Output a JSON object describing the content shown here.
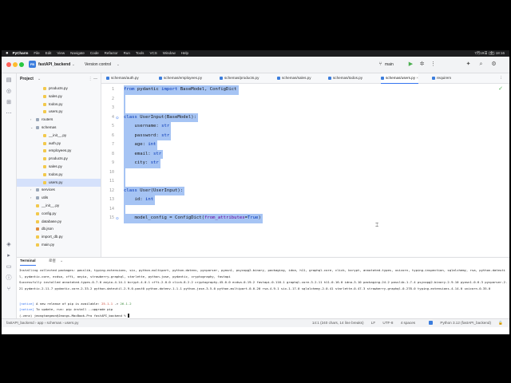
{
  "menubar": {
    "app_name": "PyCharm",
    "items": [
      "File",
      "Edit",
      "View",
      "Navigate",
      "Code",
      "Refactor",
      "Run",
      "Tools",
      "VCS",
      "Window",
      "Help"
    ],
    "status": "7月19日 (金) 18:16"
  },
  "titlebar": {
    "project_badge": "FB",
    "project_name": "fastAPI_backend",
    "vcs_label": "Version control",
    "branch": "main"
  },
  "project_panel": {
    "title": "Project",
    "rows": [
      {
        "label": "products.py",
        "depth": 3,
        "kind": "py",
        "selected": false,
        "arrow": ""
      },
      {
        "label": "sales.py",
        "depth": 3,
        "kind": "py",
        "selected": false,
        "arrow": ""
      },
      {
        "label": "todos.py",
        "depth": 3,
        "kind": "py",
        "selected": false,
        "arrow": ""
      },
      {
        "label": "users.py",
        "depth": 3,
        "kind": "py",
        "selected": false,
        "arrow": ""
      },
      {
        "label": "routers",
        "depth": 2,
        "kind": "folder",
        "selected": false,
        "arrow": "›"
      },
      {
        "label": "schemas",
        "depth": 2,
        "kind": "folder",
        "selected": false,
        "arrow": "⌄"
      },
      {
        "label": "__init__.py",
        "depth": 3,
        "kind": "py",
        "selected": false,
        "arrow": ""
      },
      {
        "label": "auth.py",
        "depth": 3,
        "kind": "py",
        "selected": false,
        "arrow": ""
      },
      {
        "label": "employees.py",
        "depth": 3,
        "kind": "py",
        "selected": false,
        "arrow": ""
      },
      {
        "label": "products.py",
        "depth": 3,
        "kind": "py",
        "selected": false,
        "arrow": ""
      },
      {
        "label": "sales.py",
        "depth": 3,
        "kind": "py",
        "selected": false,
        "arrow": ""
      },
      {
        "label": "todos.py",
        "depth": 3,
        "kind": "py",
        "selected": false,
        "arrow": ""
      },
      {
        "label": "users.py",
        "depth": 3,
        "kind": "py",
        "selected": true,
        "arrow": ""
      },
      {
        "label": "services",
        "depth": 2,
        "kind": "folder",
        "selected": false,
        "arrow": "›"
      },
      {
        "label": "utils",
        "depth": 2,
        "kind": "folder",
        "selected": false,
        "arrow": "›"
      },
      {
        "label": "__init__.py",
        "depth": 2,
        "kind": "py",
        "selected": false,
        "arrow": ""
      },
      {
        "label": "config.py",
        "depth": 2,
        "kind": "py",
        "selected": false,
        "arrow": ""
      },
      {
        "label": "database.py",
        "depth": 2,
        "kind": "py",
        "selected": false,
        "arrow": ""
      },
      {
        "label": "db.json",
        "depth": 2,
        "kind": "json",
        "selected": false,
        "arrow": ""
      },
      {
        "label": "import_db.py",
        "depth": 2,
        "kind": "py",
        "selected": false,
        "arrow": ""
      },
      {
        "label": "main.py",
        "depth": 2,
        "kind": "py",
        "selected": false,
        "arrow": ""
      }
    ]
  },
  "tabs": [
    {
      "label": "schemas/auth.py",
      "active": false
    },
    {
      "label": "schemas/employees.py",
      "active": false
    },
    {
      "label": "schemas/products.py",
      "active": false
    },
    {
      "label": "schemas/sales.py",
      "active": false
    },
    {
      "label": "schemas/todos.py",
      "active": false
    },
    {
      "label": "schemas/users.py",
      "active": true
    },
    {
      "label": "requirem",
      "active": false
    }
  ],
  "editor": {
    "lines": [
      {
        "n": "1",
        "text": "from pydantic import BaseModel, ConfigDict",
        "sel": true
      },
      {
        "n": "2",
        "text": "",
        "sel": true
      },
      {
        "n": "3",
        "text": "",
        "sel": true
      },
      {
        "n": "4",
        "text": "class UserInput(BaseModel):",
        "sel": true,
        "mark": "⊙"
      },
      {
        "n": "5",
        "text": "    username: str",
        "sel": true
      },
      {
        "n": "6",
        "text": "    password: str",
        "sel": true
      },
      {
        "n": "7",
        "text": "    age: int",
        "sel": true
      },
      {
        "n": "8",
        "text": "    email: str",
        "sel": true
      },
      {
        "n": "9",
        "text": "    city: str",
        "sel": true
      },
      {
        "n": "10",
        "text": "",
        "sel": true
      },
      {
        "n": "11",
        "text": "",
        "sel": true
      },
      {
        "n": "12",
        "text": "class User(UserInput):",
        "sel": true
      },
      {
        "n": "13",
        "text": "    id: int",
        "sel": true
      },
      {
        "n": "14",
        "text": "",
        "sel": true
      },
      {
        "n": "15",
        "text": "    model_config = ConfigDict(from_attributes=True)",
        "sel": true,
        "mark": "⊙"
      }
    ]
  },
  "terminal": {
    "tab_active": "Terminal",
    "tab_local": "로컬",
    "lines": [
      "Installing collected packages: passlib, typing-extensions, six, python-multipart, python-dotenv, pycparser, pyasn1, psycopg2-binary, packaging, idna, h11, graphql-core, click, bcrypt, annotated-types, uvicorn, typing-inspection, sqlalchemy, rsa, python-dateutil, pydantic-core, ecdsa, cffi, anyio, strawberry-graphql, starlette, python-jose, pydantic, cryptography, fastapi",
      "Successfully installed annotated-types-0.7.0 anyio-4.14.1 bcrypt-4.0.1 cffi-2.0.0 click-8.2.2 cryptography-45.0.0 ecdsa-0.19.2 fastapi-0.116.1 graphql-core-3.2.11 h11-0.16.0 idna-3.10 packaging-24.2 passlib-1.7.4 psycopg2-binary-2.9.10 pyasn1-0.6.3 pycparser-2.21 pydantic-2.11.7 pydantic-core-2.33.2 python-dateutil-2.9.0.post0 python-dotenv-1.1.1 python-jose-3.5.0 python-multipart-0.0.20 rsa-4.9.1 six-1.17.0 sqlalchemy-2.0.41 starlette-0.47.3 strawberry-graphql-0.278.0 typing-extensions-4.14.0 uvicorn-0.35.0"
    ],
    "notice1_prefix": "[notice]",
    "notice1_text": " A new release of pip is available: ",
    "notice1_old": "25.1.1",
    "notice1_arrow": " -> ",
    "notice1_new": "26.1.2",
    "notice2_prefix": "[notice]",
    "notice2_text": " To update, run: pip install --upgrade pip",
    "prompt": "(.venv) jeongtaegeon@Jeongs-MacBook-Pro fastAPI_backend % "
  },
  "statusbar": {
    "crumb": "fastAPI_backend  ›  app  ›  schemas  ›  users.py",
    "position": "14:1 (240 chars, 14 line breaks)",
    "line_sep": "LF",
    "encoding": "UTF-8",
    "indent": "4 spaces",
    "interpreter": "Python 3.12 (fastAPI_backend)"
  },
  "colors": {
    "accent": "#3574f0",
    "selection": "#a6c4f4",
    "keyword": "#0033b3"
  }
}
